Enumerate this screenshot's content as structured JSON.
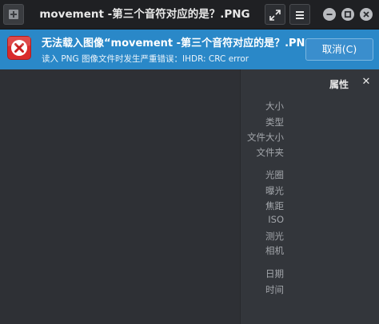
{
  "window": {
    "title": "movement -第三个音符对应的是？.PNG"
  },
  "icons": {
    "new_window": "new-window-icon",
    "fullscreen": "fullscreen-icon",
    "menu": "hamburger-menu-icon",
    "minimize": "minimize-icon",
    "maximize": "maximize-icon",
    "close": "close-icon",
    "error": "error-icon"
  },
  "banner": {
    "title": "无法载入图像“movement -第三个音符对应的是？.PNG”。",
    "detail": "读入 PNG 图像文件时发生严重错误：IHDR: CRC error",
    "cancel_label": "取消(C)",
    "color": "#2a88c8"
  },
  "properties": {
    "title": "属性",
    "close_glyph": "✕",
    "labels": [
      "大小",
      "类型",
      "文件大小",
      "文件夹",
      "光圈",
      "曝光",
      "焦距",
      "ISO",
      "测光",
      "相机",
      "日期",
      "时间"
    ]
  }
}
